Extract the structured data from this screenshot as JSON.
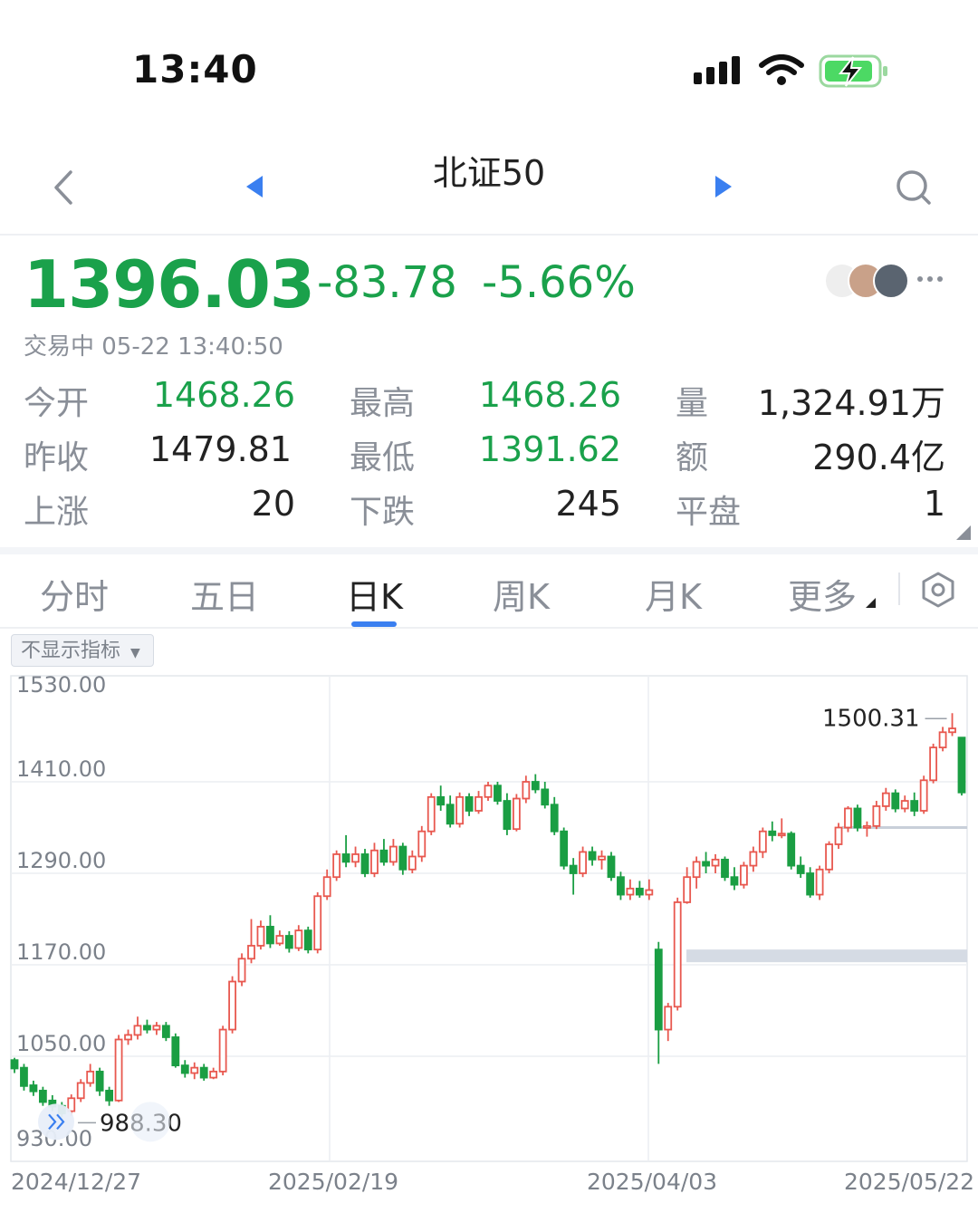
{
  "status_bar": {
    "time": "13:40"
  },
  "nav": {
    "title": "北证50"
  },
  "quote": {
    "price": "1396.03",
    "change": "-83.78",
    "change_pct": "-5.66%",
    "status_text": "交易中 05-22 13:40:50",
    "stats": {
      "open_label": "今开",
      "open": "1468.26",
      "high_label": "最高",
      "high": "1468.26",
      "volume_label": "量",
      "volume": "1,324.91万",
      "prev_close_label": "昨收",
      "prev_close": "1479.81",
      "low_label": "最低",
      "low": "1391.62",
      "amount_label": "额",
      "amount": "290.4亿",
      "up_label": "上涨",
      "up": "20",
      "down_label": "下跌",
      "down": "245",
      "flat_label": "平盘",
      "flat": "1"
    }
  },
  "tabs": [
    {
      "label": "分时",
      "active": false
    },
    {
      "label": "五日",
      "active": false
    },
    {
      "label": "日K",
      "active": true
    },
    {
      "label": "周K",
      "active": false
    },
    {
      "label": "月K",
      "active": false
    },
    {
      "label": "更多",
      "active": false
    }
  ],
  "indicator_select": {
    "label": "不显示指标"
  },
  "colors": {
    "up": "#e8584f",
    "down": "#1a9e43",
    "price_green": "#1aa14b",
    "accent": "#3a7ff0"
  },
  "icons": [
    "back-chevron-icon",
    "prev-triangle-icon",
    "next-triangle-icon",
    "search-icon",
    "signal-icon",
    "wifi-icon",
    "battery-charging-icon",
    "more-dots-icon",
    "settings-hexagon-icon",
    "expand-arrows-icon"
  ],
  "chart_data": {
    "type": "candlestick",
    "y_axis_ticks": [
      "1530.00",
      "1410.00",
      "1290.00",
      "1170.00",
      "1050.00",
      "930.00"
    ],
    "ylim": [
      930,
      1530
    ],
    "x_axis_dates": [
      "2024/12/27",
      "2025/02/19",
      "2025/04/03",
      "2025/05/22"
    ],
    "high_marker": "1500.31",
    "low_marker": "988.30",
    "candles": [
      [
        1045,
        1034,
        1048,
        1028
      ],
      [
        1035,
        1011,
        1040,
        1005
      ],
      [
        1012,
        1004,
        1018,
        998
      ],
      [
        1005,
        990,
        1010,
        985
      ],
      [
        992,
        984,
        999,
        978
      ],
      [
        985,
        975,
        990,
        970
      ],
      [
        978,
        995,
        1000,
        972
      ],
      [
        995,
        1015,
        1020,
        990
      ],
      [
        1015,
        1030,
        1040,
        1010
      ],
      [
        1030,
        1005,
        1035,
        998
      ],
      [
        1005,
        992,
        1010,
        985
      ],
      [
        992,
        1072,
        1078,
        990
      ],
      [
        1072,
        1078,
        1085,
        1065
      ],
      [
        1078,
        1090,
        1102,
        1072
      ],
      [
        1090,
        1085,
        1098,
        1080
      ],
      [
        1085,
        1090,
        1095,
        1078
      ],
      [
        1090,
        1075,
        1095,
        1070
      ],
      [
        1075,
        1038,
        1080,
        1035
      ],
      [
        1038,
        1028,
        1045,
        1022
      ],
      [
        1028,
        1035,
        1042,
        1020
      ],
      [
        1035,
        1022,
        1040,
        1018
      ],
      [
        1022,
        1030,
        1035,
        1020
      ],
      [
        1030,
        1085,
        1090,
        1025
      ],
      [
        1085,
        1148,
        1155,
        1080
      ],
      [
        1148,
        1178,
        1185,
        1142
      ],
      [
        1178,
        1195,
        1230,
        1172
      ],
      [
        1195,
        1220,
        1228,
        1190
      ],
      [
        1220,
        1198,
        1235,
        1192
      ],
      [
        1198,
        1208,
        1215,
        1195
      ],
      [
        1208,
        1192,
        1214,
        1186
      ],
      [
        1192,
        1215,
        1222,
        1188
      ],
      [
        1215,
        1190,
        1220,
        1185
      ],
      [
        1190,
        1260,
        1265,
        1185
      ],
      [
        1260,
        1285,
        1295,
        1255
      ],
      [
        1285,
        1315,
        1320,
        1280
      ],
      [
        1315,
        1305,
        1340,
        1298
      ],
      [
        1305,
        1315,
        1325,
        1298
      ],
      [
        1315,
        1290,
        1322,
        1285
      ],
      [
        1290,
        1320,
        1330,
        1285
      ],
      [
        1320,
        1305,
        1335,
        1300
      ],
      [
        1305,
        1325,
        1335,
        1300
      ],
      [
        1325,
        1295,
        1330,
        1288
      ],
      [
        1295,
        1312,
        1320,
        1290
      ],
      [
        1312,
        1345,
        1352,
        1305
      ],
      [
        1345,
        1390,
        1395,
        1340
      ],
      [
        1390,
        1380,
        1405,
        1372
      ],
      [
        1380,
        1355,
        1392,
        1350
      ],
      [
        1355,
        1390,
        1396,
        1350
      ],
      [
        1390,
        1372,
        1395,
        1365
      ],
      [
        1372,
        1390,
        1398,
        1368
      ],
      [
        1390,
        1405,
        1410,
        1385
      ],
      [
        1405,
        1385,
        1410,
        1380
      ],
      [
        1385,
        1348,
        1395,
        1340
      ],
      [
        1348,
        1388,
        1394,
        1345
      ],
      [
        1388,
        1410,
        1418,
        1382
      ],
      [
        1410,
        1400,
        1420,
        1395
      ],
      [
        1400,
        1380,
        1410,
        1375
      ],
      [
        1380,
        1345,
        1390,
        1340
      ],
      [
        1345,
        1300,
        1350,
        1295
      ],
      [
        1300,
        1290,
        1310,
        1262
      ],
      [
        1290,
        1318,
        1325,
        1285
      ],
      [
        1318,
        1308,
        1325,
        1300
      ],
      [
        1308,
        1312,
        1320,
        1295
      ],
      [
        1312,
        1285,
        1318,
        1280
      ],
      [
        1285,
        1262,
        1292,
        1255
      ],
      [
        1262,
        1270,
        1282,
        1255
      ],
      [
        1270,
        1262,
        1280,
        1258
      ],
      [
        1262,
        1268,
        1282,
        1255
      ],
      [
        1190,
        1085,
        1200,
        1040
      ],
      [
        1085,
        1115,
        1120,
        1070
      ],
      [
        1115,
        1252,
        1258,
        1110
      ],
      [
        1252,
        1285,
        1298,
        1250
      ],
      [
        1285,
        1305,
        1312,
        1270
      ],
      [
        1305,
        1300,
        1318,
        1290
      ],
      [
        1300,
        1308,
        1315,
        1290
      ],
      [
        1308,
        1285,
        1312,
        1280
      ],
      [
        1285,
        1275,
        1298,
        1268
      ],
      [
        1275,
        1300,
        1305,
        1270
      ],
      [
        1300,
        1318,
        1325,
        1292
      ],
      [
        1318,
        1345,
        1350,
        1310
      ],
      [
        1345,
        1340,
        1358,
        1332
      ],
      [
        1340,
        1342,
        1362,
        1336
      ],
      [
        1342,
        1300,
        1345,
        1295
      ],
      [
        1300,
        1290,
        1312,
        1284
      ],
      [
        1290,
        1262,
        1298,
        1258
      ],
      [
        1262,
        1295,
        1300,
        1255
      ],
      [
        1295,
        1328,
        1332,
        1290
      ],
      [
        1328,
        1350,
        1356,
        1322
      ],
      [
        1350,
        1375,
        1378,
        1344
      ],
      [
        1375,
        1350,
        1380,
        1345
      ],
      [
        1350,
        1352,
        1358,
        1338
      ],
      [
        1352,
        1378,
        1385,
        1348
      ],
      [
        1378,
        1395,
        1402,
        1372
      ],
      [
        1395,
        1375,
        1400,
        1370
      ],
      [
        1375,
        1385,
        1392,
        1370
      ],
      [
        1385,
        1372,
        1396,
        1365
      ],
      [
        1372,
        1412,
        1418,
        1368
      ],
      [
        1412,
        1455,
        1460,
        1408
      ],
      [
        1455,
        1475,
        1482,
        1450
      ],
      [
        1475,
        1480,
        1500,
        1470
      ],
      [
        1468,
        1396,
        1468,
        1392
      ]
    ]
  }
}
